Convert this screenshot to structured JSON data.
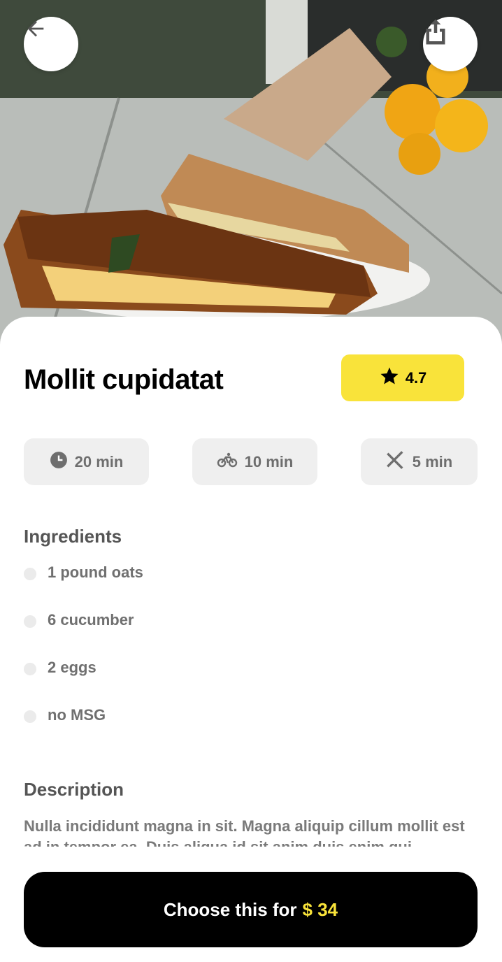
{
  "hero": {
    "image_label": "grilled cheese sandwich on plate with sunflowers"
  },
  "header": {
    "back_icon": "arrow-left-icon",
    "share_icon": "share-icon"
  },
  "recipe": {
    "title": "Mollit cupidatat",
    "rating": "4.7",
    "rating_icon": "star-icon",
    "accent_color": "#f9e33a"
  },
  "times": [
    {
      "icon": "clock-icon",
      "label": "20 min"
    },
    {
      "icon": "bicycle-icon",
      "label": "10 min"
    },
    {
      "icon": "utensils-icon",
      "label": "5 min"
    }
  ],
  "ingredients": {
    "heading": "Ingredients",
    "items": [
      "1 pound oats",
      "6 cucumber",
      "2 eggs",
      "no MSG"
    ]
  },
  "description": {
    "heading": "Description",
    "text": "Nulla incididunt magna in sit. Magna aliquip cillum mollit est ad in tempor ea. Duis aliqua id sit anim duis enim qui."
  },
  "cta": {
    "label": "Choose this for",
    "price": "$ 34"
  }
}
